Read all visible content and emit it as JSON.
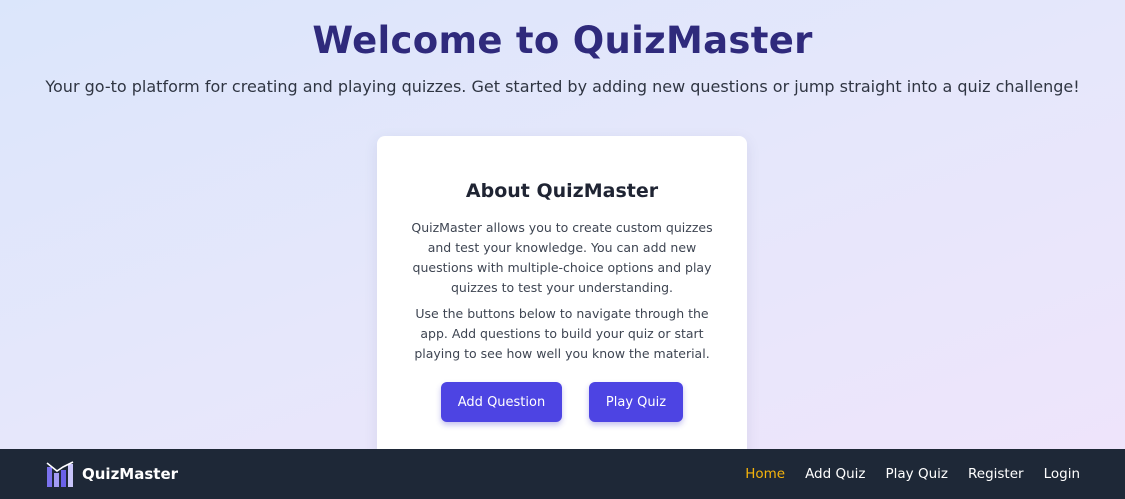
{
  "hero": {
    "title": "Welcome to QuizMaster",
    "subtitle": "Your go-to platform for creating and playing quizzes. Get started by adding new questions or jump straight into a quiz challenge!"
  },
  "about_card": {
    "title": "About QuizMaster",
    "paragraphs": [
      "QuizMaster allows you to create custom quizzes and test your knowledge. You can add new questions with multiple-choice options and play quizzes to test your understanding.",
      "Use the buttons below to navigate through the app. Add questions to build your quiz or start playing to see how well you know the material."
    ],
    "buttons": {
      "add_question": "Add Question",
      "play_quiz": "Play Quiz"
    }
  },
  "navbar": {
    "brand": "QuizMaster",
    "logo_icon": "bar-chart-logo-icon",
    "links": [
      {
        "label": "Home",
        "active": true
      },
      {
        "label": "Add Quiz",
        "active": false
      },
      {
        "label": "Play Quiz",
        "active": false
      },
      {
        "label": "Register",
        "active": false
      },
      {
        "label": "Login",
        "active": false
      }
    ]
  },
  "colors": {
    "accent": "#4d44e3",
    "title": "#2f2a7c",
    "navbar_bg": "#1e2837",
    "active_link": "#f5b30b"
  }
}
